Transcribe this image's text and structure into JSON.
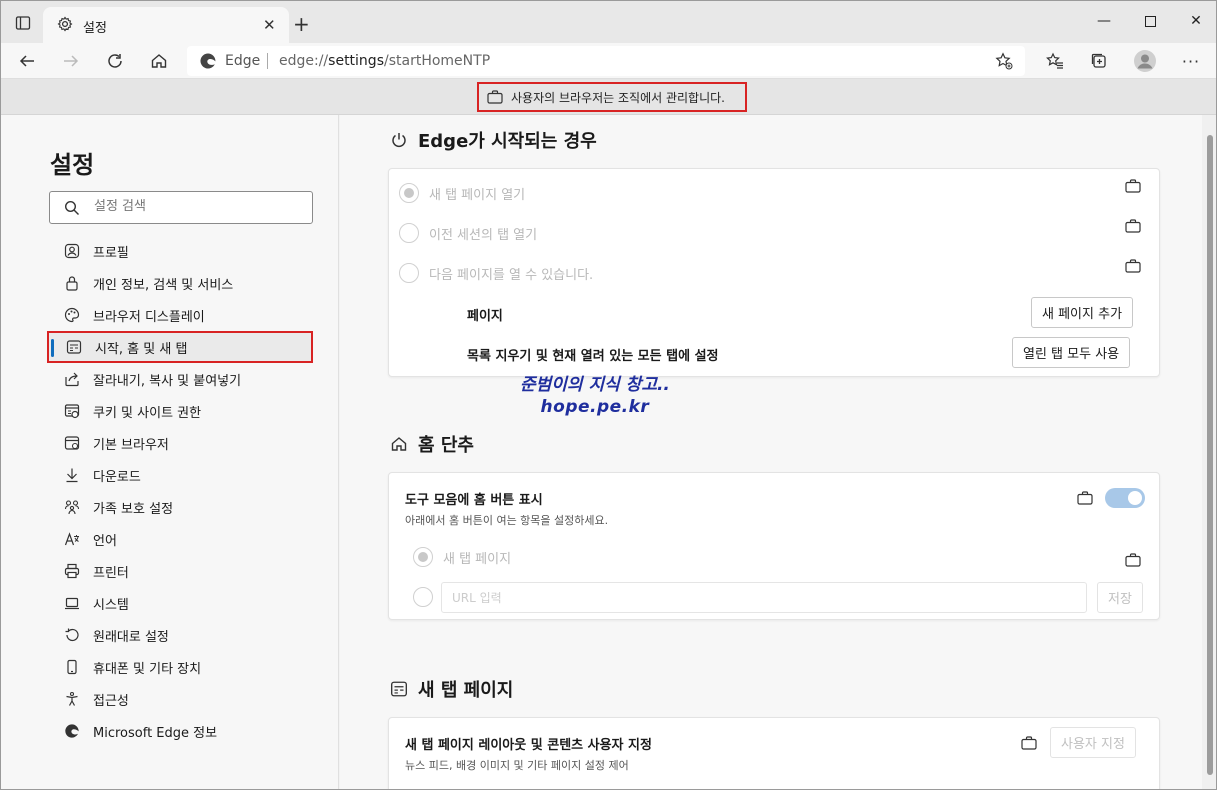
{
  "browser": {
    "tab_title": "설정",
    "omnibox_site": "Edge",
    "omnibox_url_prefix": "edge://",
    "omnibox_url_host": "settings",
    "omnibox_url_path": "/startHomeNTP"
  },
  "managed_notice": "사용자의 브라우저는 조직에서 관리합니다.",
  "sidebar": {
    "title": "설정",
    "search_placeholder": "설정 검색",
    "items": [
      {
        "label": "프로필",
        "icon": "profile-icon"
      },
      {
        "label": "개인 정보, 검색 및 서비스",
        "icon": "lock-icon"
      },
      {
        "label": "브라우저 디스플레이",
        "icon": "palette-icon"
      },
      {
        "label": "시작, 홈 및 새 탭",
        "icon": "newtab-icon",
        "active": true
      },
      {
        "label": "잘라내기, 복사 및 붙여넣기",
        "icon": "share-icon"
      },
      {
        "label": "쿠키 및 사이트 권한",
        "icon": "cookie-icon"
      },
      {
        "label": "기본 브라우저",
        "icon": "browser-icon"
      },
      {
        "label": "다운로드",
        "icon": "download-icon"
      },
      {
        "label": "가족 보호 설정",
        "icon": "family-icon"
      },
      {
        "label": "언어",
        "icon": "language-icon"
      },
      {
        "label": "프린터",
        "icon": "printer-icon"
      },
      {
        "label": "시스템",
        "icon": "system-icon"
      },
      {
        "label": "원래대로 설정",
        "icon": "reset-icon"
      },
      {
        "label": "휴대폰 및 기타 장치",
        "icon": "phone-icon"
      },
      {
        "label": "접근성",
        "icon": "accessibility-icon"
      },
      {
        "label": "Microsoft Edge 정보",
        "icon": "edge-icon"
      }
    ]
  },
  "startup": {
    "title": "Edge가 시작되는 경우",
    "options": [
      "새 탭 페이지 열기",
      "이전 세션의 탭 열기",
      "다음 페이지를 열 수 있습니다."
    ],
    "pages_label": "페이지",
    "add_page_button": "새 페이지 추가",
    "clear_label": "목록 지우기 및 현재 열려 있는 모든 탭에 설정",
    "use_open_tabs_button": "열린 탭 모두 사용"
  },
  "watermark": {
    "line1": "준범이의 지식 창고..",
    "line2": "hope.pe.kr"
  },
  "home": {
    "title": "홈 단추",
    "show_home_label": "도구 모음에 홈 버튼 표시",
    "show_home_sub": "아래에서 홈 버튼이 여는 항목을 설정하세요.",
    "toggle_on": true,
    "option_newtab": "새 탭 페이지",
    "url_placeholder": "URL 입력",
    "save_button": "저장"
  },
  "newtab": {
    "title": "새 탭 페이지",
    "customize_label": "새 탭 페이지 레이아웃 및 콘텐츠 사용자 지정",
    "customize_sub": "뉴스 피드, 배경 이미지 및 기타 페이지 설정 제어",
    "customize_button": "사용자 지정"
  }
}
